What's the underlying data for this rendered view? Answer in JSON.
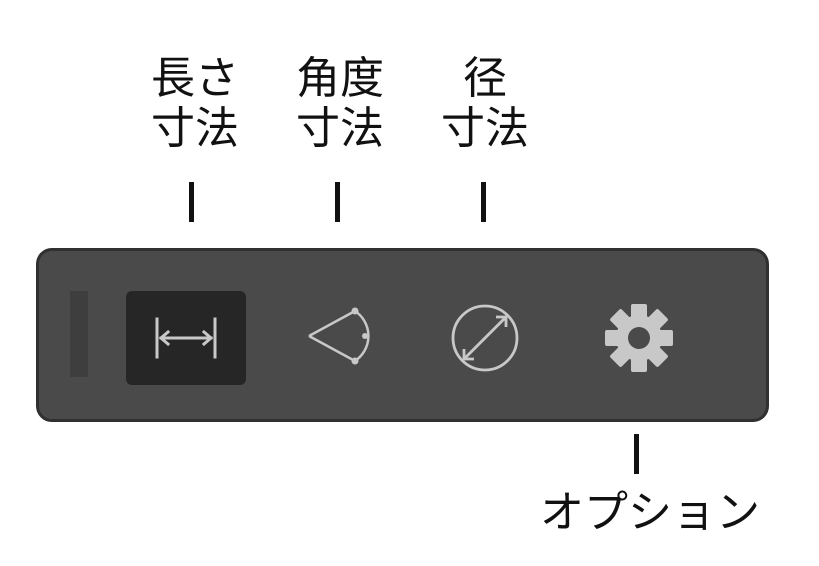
{
  "callouts": {
    "length_dimension": {
      "line1": "長さ",
      "line2": "寸法"
    },
    "angle_dimension": {
      "line1": "角度",
      "line2": "寸法"
    },
    "diameter_dimension": {
      "line1": "径",
      "line2": "寸法"
    },
    "options": {
      "line1": "オプション"
    }
  },
  "toolbar": {
    "tools": [
      {
        "id": "length-dimension",
        "icon": "length-dimension-icon",
        "active": true
      },
      {
        "id": "angle-dimension",
        "icon": "angle-dimension-icon",
        "active": false
      },
      {
        "id": "diameter-dimension",
        "icon": "diameter-dimension-icon",
        "active": false
      },
      {
        "id": "options",
        "icon": "gear-icon",
        "active": false
      }
    ]
  },
  "colors": {
    "toolbar_bg": "#4a4a4a",
    "toolbar_border": "#303030",
    "active_button_bg": "#262626",
    "icon": "#c8c8c8",
    "label_text": "#111111"
  }
}
